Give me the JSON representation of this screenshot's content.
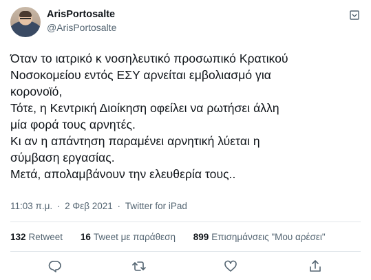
{
  "user": {
    "display_name": "ArisPortosalte",
    "handle": "@ArisPortosalte"
  },
  "tweet": {
    "lines": [
      "Όταν το ιατρικό κ νοσηλευτικό προσωπικό Κρατικού",
      "Νοσοκομείου εντός ΕΣΥ αρνείται εμβολιασμό για",
      "κορονοϊό,",
      "Τότε, η Κεντρική Διοίκηση οφείλει να ρωτήσει άλλη",
      "μία φορά τους αρνητές.",
      "Κι αν η απάντηση παραμένει αρνητική λύεται η",
      "σύμβαση εργασίας.",
      "Μετά, απολαμβάνουν την ελευθερία τους.."
    ],
    "time": "11:03 π.μ.",
    "separator": "·",
    "date": "2 Φεβ 2021",
    "source": "Twitter for iPad"
  },
  "stats": {
    "retweets_count": "132",
    "retweets_label": "Retweet",
    "quotes_count": "16",
    "quotes_label": "Tweet με παράθεση",
    "likes_count": "899",
    "likes_label": "Επισημάνσεις \"Μου αρέσει\""
  },
  "icons": {
    "more": "more-icon",
    "reply": "reply-icon",
    "retweet": "retweet-icon",
    "like": "like-icon",
    "share": "share-icon"
  },
  "colors": {
    "text": "#0f1419",
    "secondary": "#536471",
    "divider": "#e1e6ea"
  }
}
